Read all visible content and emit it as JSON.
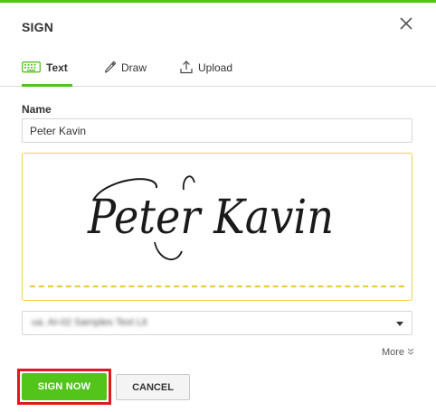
{
  "dialog": {
    "title": "SIGN"
  },
  "tabs": [
    {
      "label": "Text",
      "icon": "keyboard-icon",
      "active": true
    },
    {
      "label": "Draw",
      "icon": "pen-icon",
      "active": false
    },
    {
      "label": "Upload",
      "icon": "upload-icon",
      "active": false
    }
  ],
  "name_field": {
    "label": "Name",
    "value": "Peter Kavin"
  },
  "signature_preview": {
    "text": "Peter Kavin"
  },
  "font_select": {
    "value": "ua. AI-02 Samples Text Lit"
  },
  "more_link": {
    "label": "More"
  },
  "buttons": {
    "sign_now": "SIGN NOW",
    "cancel": "CANCEL"
  },
  "colors": {
    "accent": "#52c41a",
    "highlight": "#e0191d",
    "signature_box_border": "#f0d24a"
  }
}
